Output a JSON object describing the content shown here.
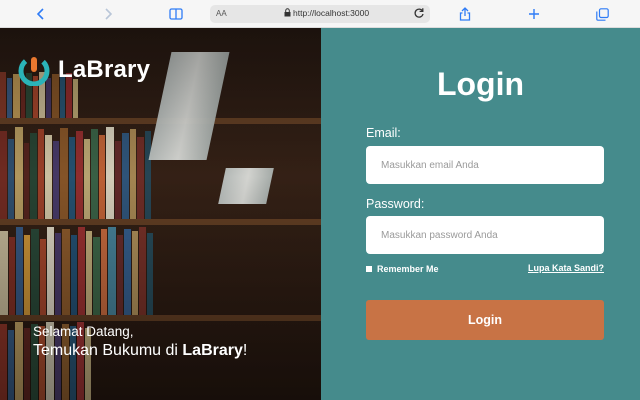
{
  "browser": {
    "text_size_label": "AA",
    "url": "http://localhost:3000",
    "icons": [
      "back-icon",
      "forward-icon",
      "book-icon",
      "lock-icon",
      "reload-icon",
      "share-icon",
      "new-tab-icon",
      "tabs-icon"
    ]
  },
  "hero": {
    "brand": "LaBrary",
    "welcome_line1": "Selamat Datang,",
    "welcome_line2_prefix": "Temukan Bukumu di ",
    "welcome_line2_brand": "LaBrary",
    "welcome_line2_suffix": "!"
  },
  "login": {
    "title": "Login",
    "email_label": "Email:",
    "email_placeholder": "Masukkan email Anda",
    "email_value": "",
    "password_label": "Password:",
    "password_placeholder": "Masukkan password Anda",
    "password_value": "",
    "remember_label": "Remember Me",
    "forgot_link": "Lupa Kata Sandi?",
    "submit_label": "Login"
  },
  "colors": {
    "panel_bg": "#458b8c",
    "button_bg": "#c87345",
    "logo_teal": "#2bb3b8",
    "logo_orange": "#e9782f",
    "browser_accent": "#2f7cf6"
  }
}
